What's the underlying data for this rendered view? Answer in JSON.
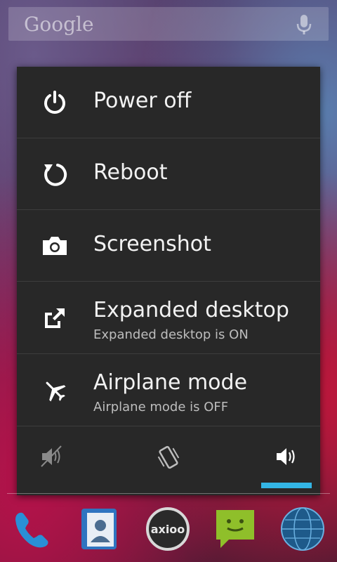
{
  "search": {
    "logo_text": "Google",
    "icon": "mic-icon"
  },
  "power_menu": {
    "items": [
      {
        "icon": "power-icon",
        "label": "Power off",
        "subtitle": ""
      },
      {
        "icon": "reboot-icon",
        "label": "Reboot",
        "subtitle": ""
      },
      {
        "icon": "camera-icon",
        "label": "Screenshot",
        "subtitle": ""
      },
      {
        "icon": "expand-icon",
        "label": "Expanded desktop",
        "subtitle": "Expanded desktop is ON"
      },
      {
        "icon": "airplane-icon",
        "label": "Airplane mode",
        "subtitle": "Airplane mode is OFF"
      }
    ],
    "sound_modes": [
      {
        "icon": "silent-icon",
        "selected": false
      },
      {
        "icon": "vibrate-icon",
        "selected": false
      },
      {
        "icon": "sound-on-icon",
        "selected": true
      }
    ]
  },
  "dock": {
    "apps": [
      {
        "icon": "phone-icon"
      },
      {
        "icon": "contacts-icon"
      },
      {
        "icon": "axioo-app-icon",
        "text": "axioo"
      },
      {
        "icon": "messaging-icon"
      },
      {
        "icon": "browser-globe-icon"
      }
    ]
  },
  "colors": {
    "accent": "#33b5e5",
    "dialog_bg": "#282828",
    "text": "#f2f2f2",
    "subtext": "#bdbdbd"
  }
}
